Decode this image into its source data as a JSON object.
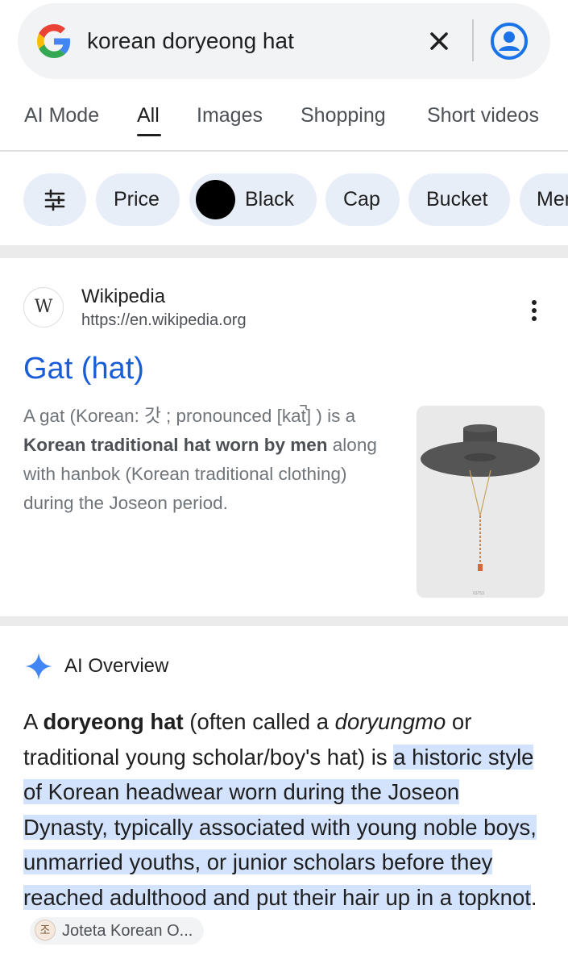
{
  "search": {
    "query": "korean doryeong hat"
  },
  "tabs": [
    {
      "label": "AI Mode"
    },
    {
      "label": "All"
    },
    {
      "label": "Images"
    },
    {
      "label": "Shopping"
    },
    {
      "label": "Short videos"
    }
  ],
  "chips": [
    {
      "label": "Price"
    },
    {
      "label": "Black"
    },
    {
      "label": "Cap"
    },
    {
      "label": "Bucket"
    },
    {
      "label": "Men"
    }
  ],
  "result": {
    "site_icon_text": "W",
    "site_name": "Wikipedia",
    "site_url": "https://en.wikipedia.org",
    "title": "Gat (hat)",
    "snippet_1": "A gat (Korean: 갓 ; pronounced [kat̚] ) is a ",
    "snippet_bold": "Korean traditional hat worn by men",
    "snippet_2": " along with hanbok (Korean traditional clothing) during the Joseon period.",
    "thumb_caption": "63753"
  },
  "ai_overview": {
    "heading": "AI Overview",
    "text_1": "A ",
    "bold_1": "doryeong hat",
    "text_2": " (often called a ",
    "italic_1": "doryungmo",
    "text_3": " or traditional young scholar/boy's hat) is ",
    "highlight": "a historic style of Korean headwear worn during the Joseon Dynasty, typically associated with young noble boys, unmarried youths, or junior scholars before they reached adulthood and put their hair up in a topknot",
    "text_4": ".",
    "source_icon": "조",
    "source_label": "Joteta Korean O..."
  },
  "colors": {
    "link_blue": "#1a5dd8",
    "chip_bg": "#e8eef8",
    "highlight": "#d3e3fd",
    "ai_star": "#4285f4"
  },
  "icons": [
    "google-logo-icon",
    "close-icon",
    "account-icon",
    "filter-sliders-icon",
    "more-vert-icon",
    "sparkle-icon"
  ]
}
